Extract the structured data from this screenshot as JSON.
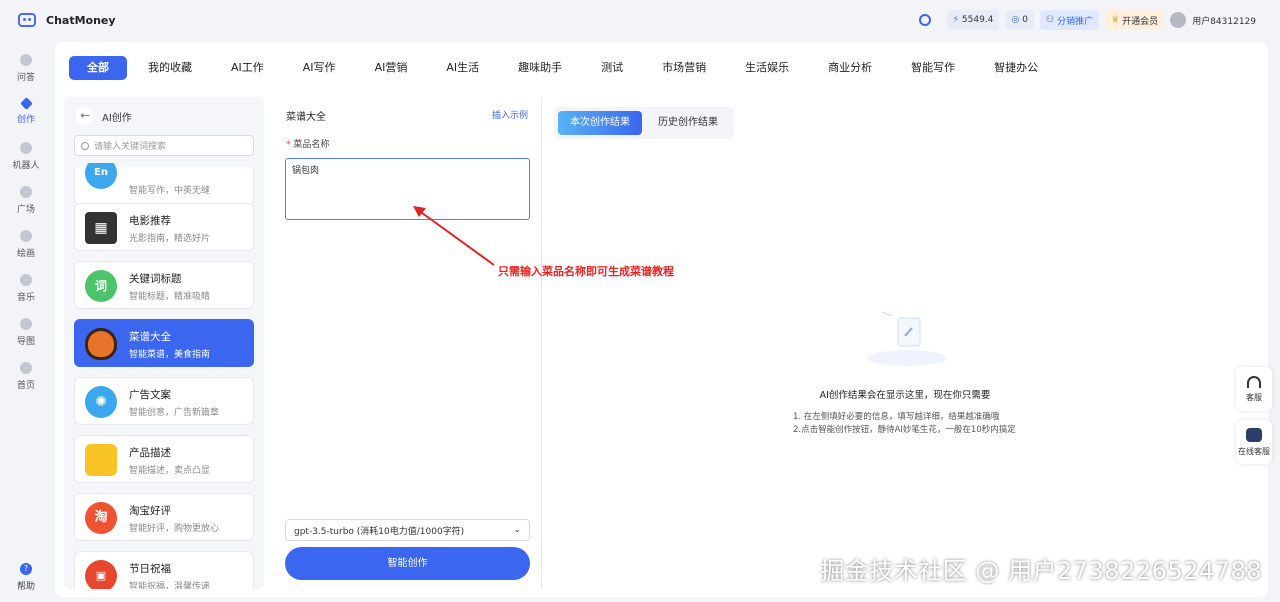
{
  "app": {
    "title": "ChatMoney"
  },
  "header": {
    "balance": "5549.4",
    "count": "0",
    "affiliate": "分销推广",
    "vip": "开通会员",
    "user": "用户84312129"
  },
  "sidebar": {
    "items": [
      {
        "label": "问答",
        "icon": "chat-icon"
      },
      {
        "label": "创作",
        "icon": "pen-icon",
        "active": true
      },
      {
        "label": "机器人",
        "icon": "robot-icon"
      },
      {
        "label": "广场",
        "icon": "grid-icon"
      },
      {
        "label": "绘画",
        "icon": "palette-icon"
      },
      {
        "label": "音乐",
        "icon": "music-icon"
      },
      {
        "label": "导图",
        "icon": "map-icon"
      },
      {
        "label": "首页",
        "icon": "home-icon"
      }
    ],
    "help": "帮助"
  },
  "categories": [
    "全部",
    "我的收藏",
    "AI工作",
    "AI写作",
    "AI营销",
    "AI生活",
    "趣味助手",
    "测试",
    "市场营销",
    "生活娱乐",
    "商业分析",
    "智能写作",
    "智捷办公"
  ],
  "left": {
    "title": "AI创作",
    "search_placeholder": "请输入关键词搜索",
    "cards": [
      {
        "title": "",
        "desc": "智能写作，中英无缝",
        "icon": "En",
        "color": "#3aa7ee"
      },
      {
        "title": "电影推荐",
        "desc": "光影指南，精选好片",
        "icon": "🎬",
        "color": "#ffffff"
      },
      {
        "title": "关键词标题",
        "desc": "智能标题，精准吸睛",
        "icon": "词",
        "color": "#4cc46a"
      },
      {
        "title": "菜谱大全",
        "desc": "智能菜谱，美食指南",
        "icon": "🍲",
        "color": "#3b66f0",
        "active": true
      },
      {
        "title": "广告文案",
        "desc": "智能创意，广告新篇章",
        "icon": "💡",
        "color": "#3aa7ee"
      },
      {
        "title": "产品描述",
        "desc": "智能描述，卖点凸显",
        "icon": "🛍",
        "color": "#f7c325"
      },
      {
        "title": "淘宝好评",
        "desc": "智能好评，购物更放心",
        "icon": "淘",
        "color": "#f0532f"
      },
      {
        "title": "节日祝福",
        "desc": "智能祝福，温馨传递",
        "icon": "福",
        "color": "#e8472f"
      }
    ]
  },
  "form": {
    "title": "菜谱大全",
    "example": "插入示例",
    "label_req": "*",
    "label": "菜品名称",
    "value": "锅包肉",
    "model": "gpt-3.5-turbo (消耗10电力值/1000字符)",
    "submit": "智能创作"
  },
  "result": {
    "tabs": [
      "本次创作结果",
      "历史创作结果"
    ],
    "empty_title": "AI创作结果会在显示这里，现在你只需要",
    "tip1": "1. 在左侧填好必要的信息，填写越详细，结果越准确哦",
    "tip2": "2.点击智能创作按钮，静待AI妙笔生花，一般在10秒内搞定"
  },
  "annotation": "只需输入菜品名称即可生成菜谱教程",
  "float": {
    "service": "客服",
    "online": "在线客服"
  },
  "watermark": "掘金技术社区 @ 用户2738226524788",
  "colors": {
    "accent": "#3b66f0",
    "annotation": "#e22222"
  }
}
